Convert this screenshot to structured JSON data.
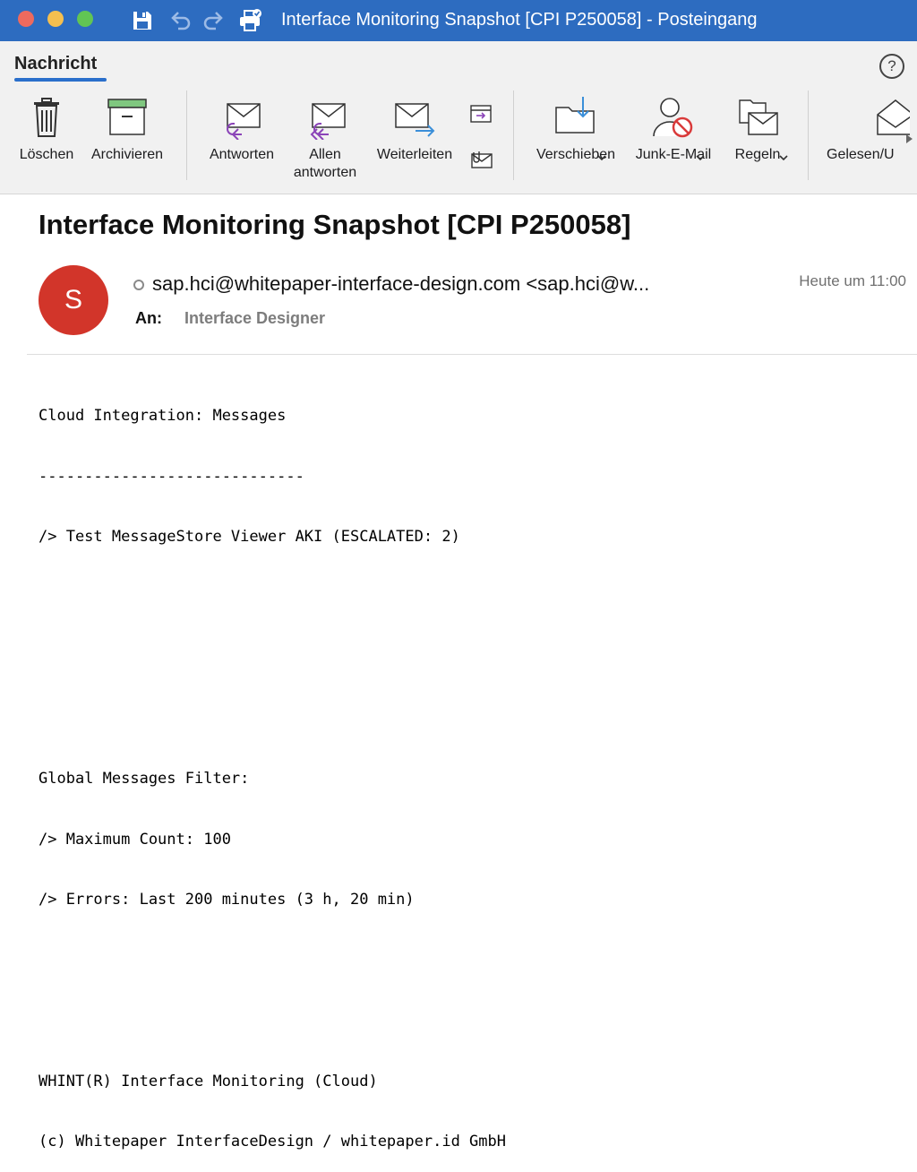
{
  "window": {
    "title": "Interface Monitoring Snapshot [CPI P250058] - Posteingang"
  },
  "ribbon": {
    "tab_label": "Nachricht",
    "help_label": "?",
    "buttons": {
      "delete": "Löschen",
      "archive": "Archivieren",
      "reply": "Antworten",
      "reply_all_line1": "Allen",
      "reply_all_line2": "antworten",
      "forward": "Weiterleiten",
      "move": "Verschieben",
      "junk": "Junk-E-Mail",
      "rules": "Regeln",
      "read_unread": "Gelesen/U"
    },
    "icons": [
      "trash-icon",
      "archive-icon",
      "reply-icon",
      "reply-all-icon",
      "forward-icon",
      "meeting-icon",
      "attachment-icon",
      "move-icon",
      "junk-icon",
      "rules-icon",
      "read-unread-icon"
    ]
  },
  "message": {
    "subject": "Interface Monitoring Snapshot [CPI P250058]",
    "avatar_initial": "S",
    "avatar_color": "#d2352a",
    "sender": "sap.hci@whitepaper-interface-design.com <sap.hci@w...",
    "date": "Heute um 11:00",
    "to_label": "An:",
    "to_value": "Interface Designer"
  },
  "body_lines": [
    "Cloud Integration: Messages",
    "-----------------------------",
    "/> Test MessageStore Viewer AKI (ESCALATED: 2)",
    "",
    "",
    "",
    "Global Messages Filter:",
    "/> Maximum Count: 100",
    "/> Errors: Last 200 minutes (3 h, 20 min)",
    "",
    "",
    "WHINT(R) Interface Monitoring (Cloud)",
    "(c) Whitepaper InterfaceDesign / whitepaper.id GmbH"
  ],
  "colors": {
    "titlebar": "#2d6cc0",
    "accent": "#2a6fcb",
    "reply_arrow": "#8b44b8",
    "forward_arrow": "#3b8fd9",
    "junk_red": "#d93a3a"
  }
}
